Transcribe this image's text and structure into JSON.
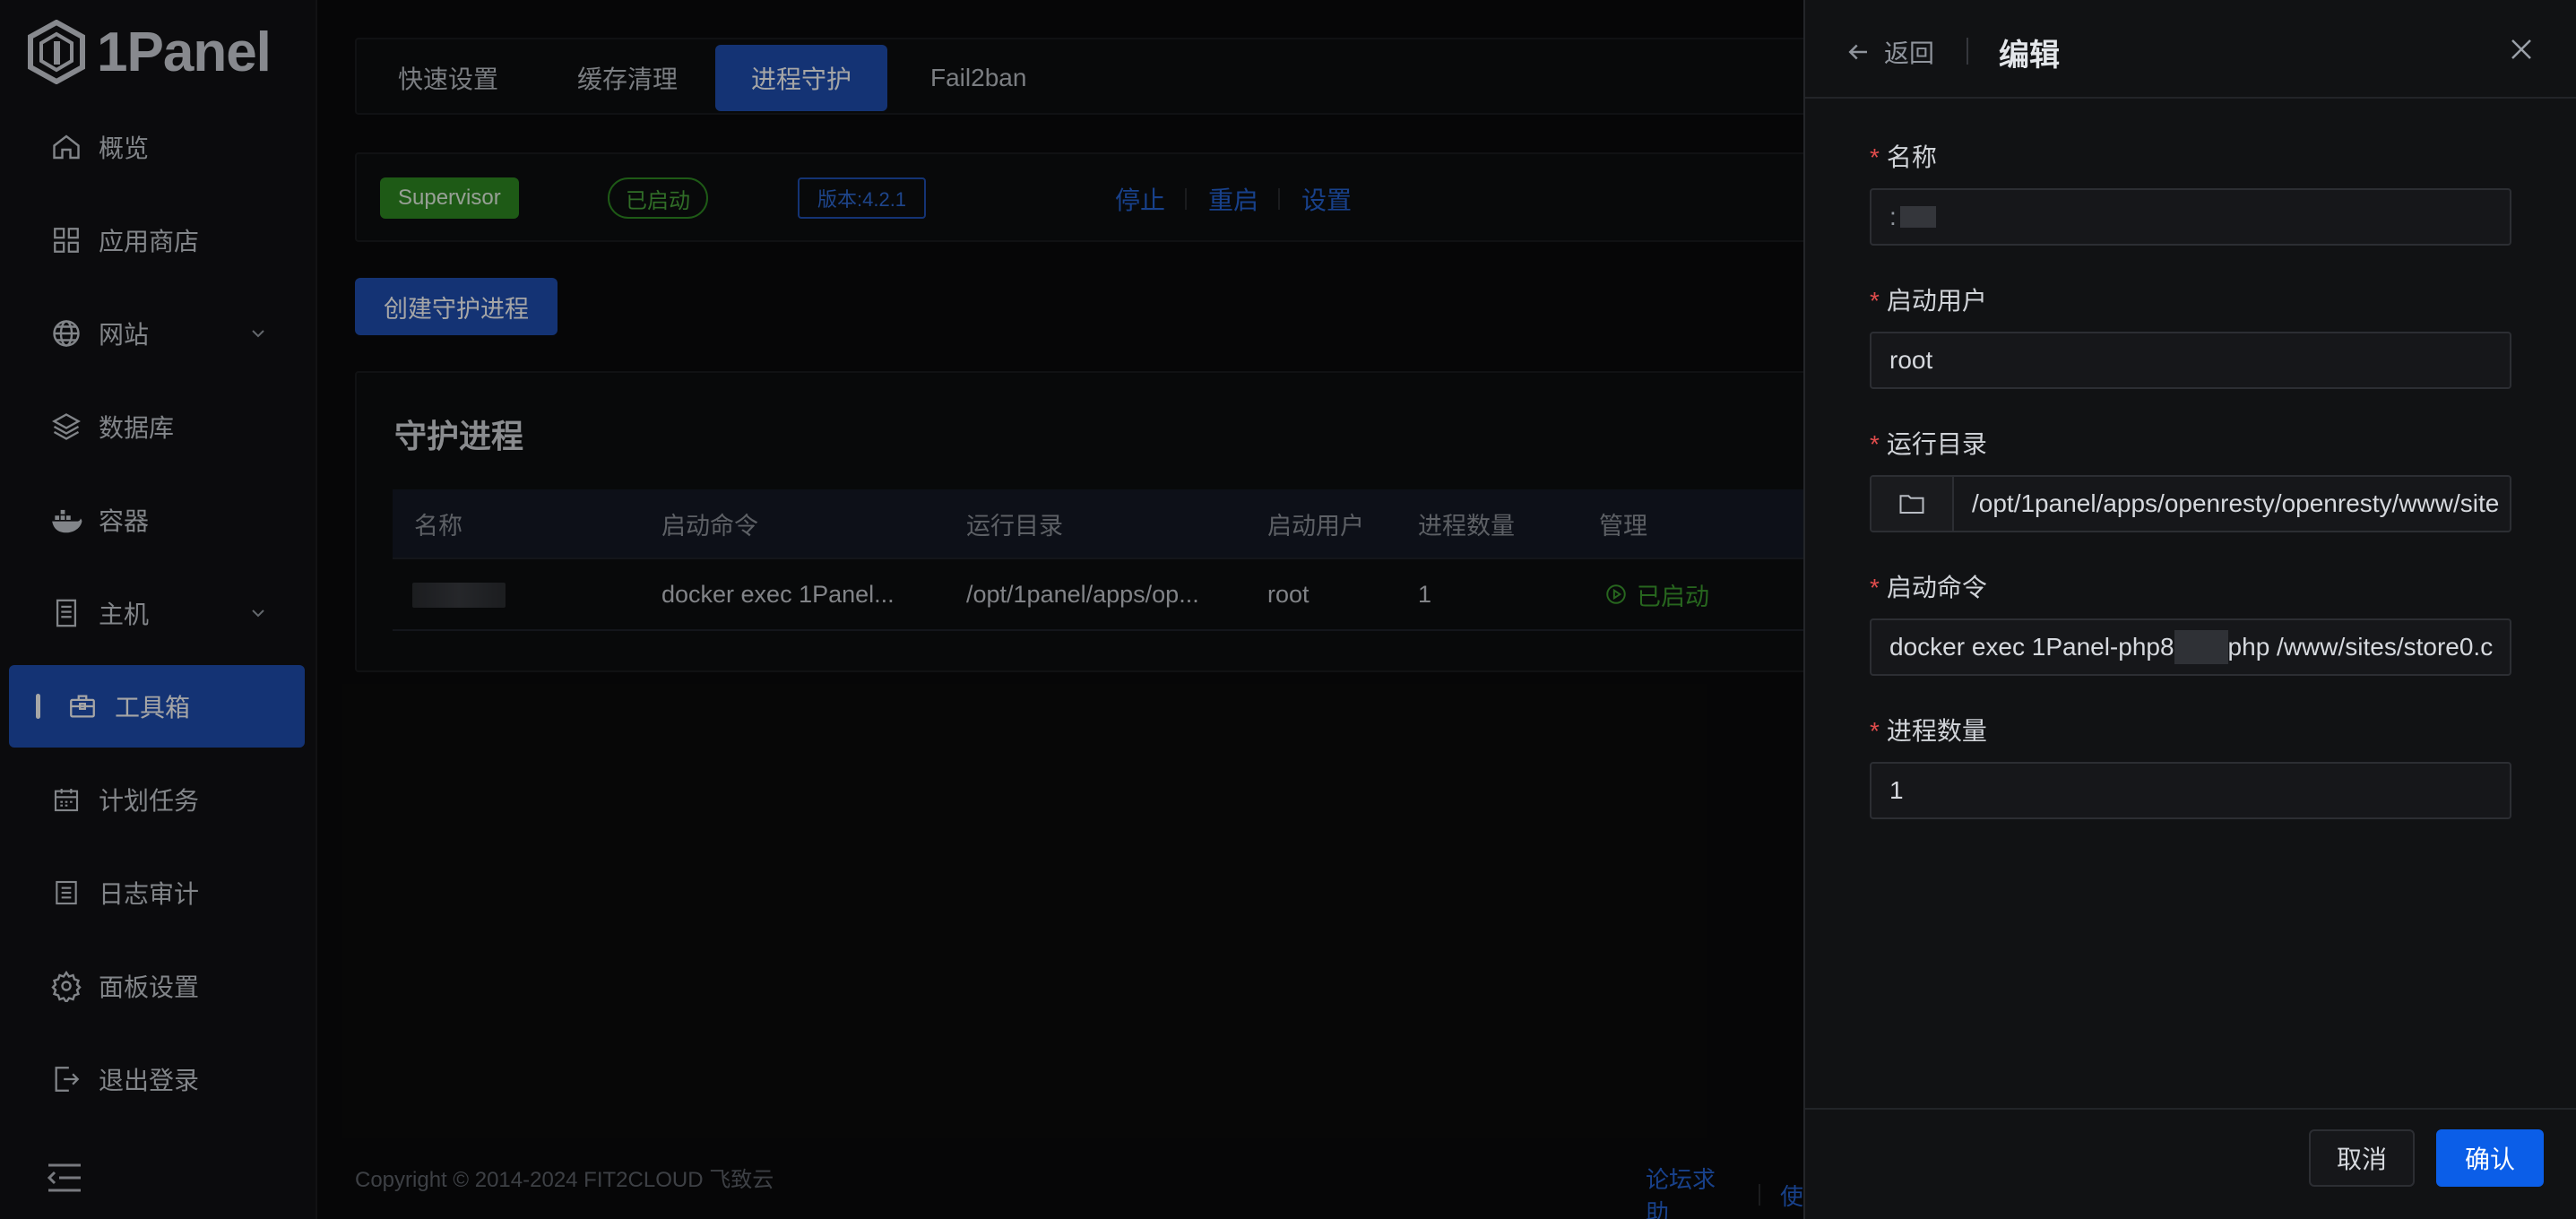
{
  "app": {
    "logo_text": "1Panel"
  },
  "sidebar": {
    "items": [
      {
        "label": "概览",
        "icon": "home-icon"
      },
      {
        "label": "应用商店",
        "icon": "grid-icon"
      },
      {
        "label": "网站",
        "icon": "globe-icon",
        "expandable": true
      },
      {
        "label": "数据库",
        "icon": "layers-icon"
      },
      {
        "label": "容器",
        "icon": "docker-icon"
      },
      {
        "label": "主机",
        "icon": "server-icon",
        "expandable": true
      },
      {
        "label": "工具箱",
        "icon": "toolbox-icon",
        "active": true
      },
      {
        "label": "计划任务",
        "icon": "calendar-icon"
      },
      {
        "label": "日志审计",
        "icon": "log-icon"
      },
      {
        "label": "面板设置",
        "icon": "gear-icon"
      },
      {
        "label": "退出登录",
        "icon": "logout-icon"
      }
    ]
  },
  "tabs": [
    {
      "label": "快速设置"
    },
    {
      "label": "缓存清理"
    },
    {
      "label": "进程守护",
      "active": true
    },
    {
      "label": "Fail2ban"
    }
  ],
  "supervisor": {
    "name": "Supervisor",
    "status": "已启动",
    "version": "版本:4.2.1",
    "actions": [
      "停止",
      "重启",
      "设置"
    ]
  },
  "create_button": "创建守护进程",
  "process_card": {
    "title": "守护进程",
    "columns": [
      "名称",
      "启动命令",
      "运行目录",
      "启动用户",
      "进程数量",
      "管理"
    ],
    "rows": [
      {
        "command": "docker exec 1Panel...",
        "dir": "/opt/1panel/apps/op...",
        "user": "root",
        "count": "1",
        "status": "已启动"
      }
    ]
  },
  "footer": {
    "copyright": "Copyright © 2014-2024 FIT2CLOUD 飞致云",
    "links": [
      "论坛求助",
      "使"
    ]
  },
  "drawer": {
    "back_label": "返回",
    "title": "编辑",
    "fields": {
      "name_label": "名称",
      "user_label": "启动用户",
      "user_value": "root",
      "dir_label": "运行目录",
      "dir_value": "/opt/1panel/apps/openresty/openresty/www/site",
      "cmd_label": "启动命令",
      "cmd_prefix": "docker exec 1Panel-php8",
      "cmd_suffix": "php /www/sites/store0.c",
      "count_label": "进程数量",
      "count_value": "1"
    },
    "cancel_label": "取消",
    "confirm_label": "确认"
  },
  "colors": {
    "accent": "#1f4fb3",
    "confirm": "#0b5ee8",
    "success": "#2f8a23",
    "link": "#2664d6",
    "required": "#e04c4c"
  }
}
